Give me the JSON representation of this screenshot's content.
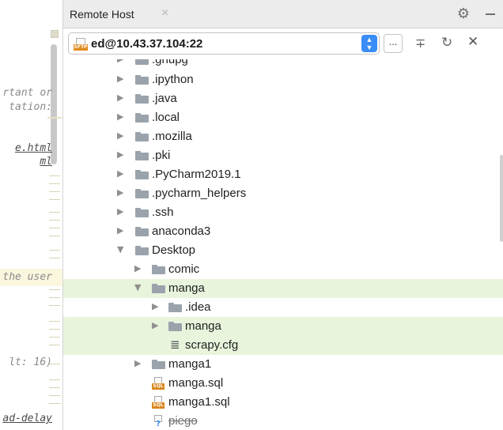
{
  "editor": {
    "snippets": [
      "rtant or",
      "tation:",
      "e.html",
      "ml",
      "the user",
      "lt: 16)",
      "ad-delay"
    ]
  },
  "panel": {
    "title": "Remote Host",
    "close_glyph": "×"
  },
  "toolbar": {
    "host_icon_tag": "SFTP",
    "host": "ed@10.43.37.104:22",
    "more_label": "...",
    "collapse_glyph": "∓",
    "refresh_glyph": "↻",
    "close_glyph": "✕"
  },
  "tree": {
    "items": [
      {
        "label": ".gnupg",
        "expanded": false
      },
      {
        "label": ".ipython",
        "expanded": false
      },
      {
        "label": ".java",
        "expanded": false
      },
      {
        "label": ".local",
        "expanded": false
      },
      {
        "label": ".mozilla",
        "expanded": false
      },
      {
        "label": ".pki",
        "expanded": false
      },
      {
        "label": ".PyCharm2019.1",
        "expanded": false
      },
      {
        "label": ".pycharm_helpers",
        "expanded": false
      },
      {
        "label": ".ssh",
        "expanded": false
      },
      {
        "label": "anaconda3",
        "expanded": false
      },
      {
        "label": "Desktop",
        "expanded": true
      },
      {
        "label": "comic",
        "expanded": false
      },
      {
        "label": "manga",
        "expanded": true
      },
      {
        "label": ".idea",
        "expanded": false
      },
      {
        "label": "manga",
        "expanded": false
      },
      {
        "label": "scrapy.cfg"
      },
      {
        "label": "manga1",
        "expanded": false
      },
      {
        "label": "manga.sql",
        "tag": "SQL"
      },
      {
        "label": "manga1.sql",
        "tag": "SQL"
      },
      {
        "label": "piego",
        "tag": "?"
      }
    ]
  },
  "icons": {
    "folder": "folder-icon",
    "settings": "gear-icon",
    "minimize": "minimize-icon"
  },
  "colors": {
    "selection": "#e8f4dc",
    "accent": "#3a8cf6",
    "sql_badge": "#d9861c",
    "sftp_badge": "#e08a1e"
  }
}
